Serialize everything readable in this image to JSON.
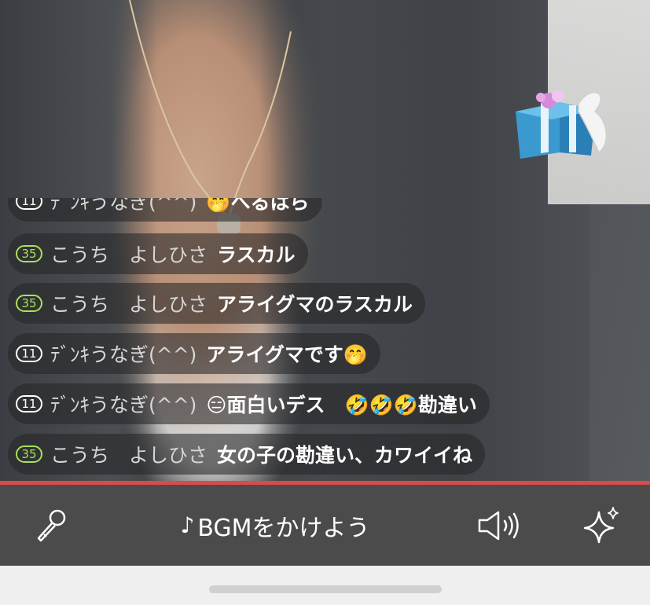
{
  "chat": {
    "messages": [
      {
        "level": "11",
        "user": "ﾃﾞﾝｷうなぎ(^^)",
        "text": "🤭へるはら",
        "level_color": "#ffffff"
      },
      {
        "level": "35",
        "user": "こうち　よしひさ",
        "text": "ラスカル",
        "level_color": "#a8e05a"
      },
      {
        "level": "35",
        "user": "こうち　よしひさ",
        "text": "アライグマのラスカル",
        "level_color": "#a8e05a"
      },
      {
        "level": "11",
        "user": "ﾃﾞﾝｷうなぎ(^^)",
        "text": "アライグマです🤭",
        "level_color": "#ffffff"
      },
      {
        "level": "11",
        "user": "ﾃﾞﾝｷうなぎ(^^)",
        "text": "😑面白いデス　🤣🤣🤣勘違い",
        "level_color": "#ffffff"
      },
      {
        "level": "35",
        "user": "こうち　よしひさ",
        "text": "女の子の勘違い、カワイイね",
        "level_color": "#a8e05a"
      }
    ]
  },
  "toolbar": {
    "mic_icon": "microphone-icon",
    "bgm_label": "BGMをかけよう",
    "speaker_icon": "speaker-icon",
    "effects_icon": "sparkle-icon"
  },
  "overlay": {
    "gift_icon": "gift-box-icon"
  },
  "colors": {
    "accent_line": "#d94b4b",
    "toolbar_bg": "#4b4b4b",
    "level_green": "#a8e05a"
  }
}
